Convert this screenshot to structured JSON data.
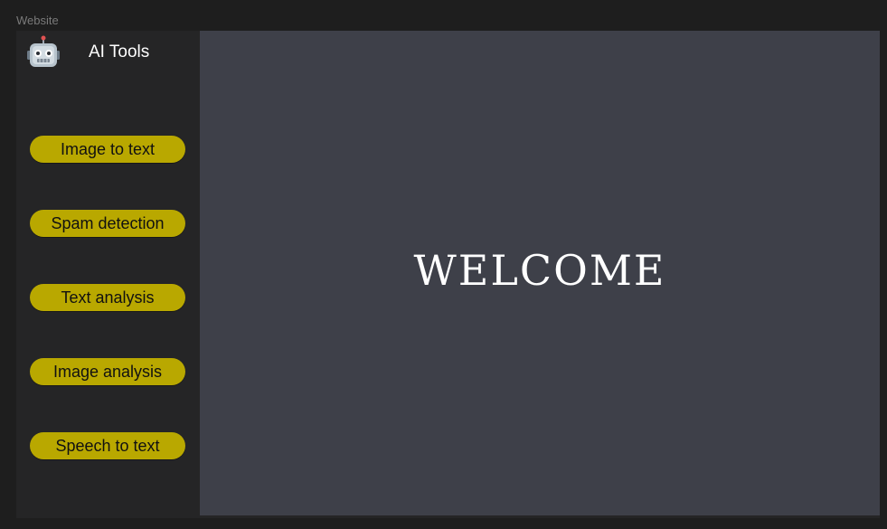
{
  "frame": {
    "label": "Website"
  },
  "sidebar": {
    "brand": {
      "icon": "robot-icon",
      "title": "AI Tools"
    },
    "items": [
      {
        "label": "Image to text"
      },
      {
        "label": "Spam detection"
      },
      {
        "label": "Text analysis"
      },
      {
        "label": "Image analysis"
      },
      {
        "label": "Speech to text"
      }
    ]
  },
  "main": {
    "heading": "WELCOME"
  },
  "colors": {
    "page_background": "#1e1e1e",
    "sidebar_background": "#252526",
    "main_background": "#3e4049",
    "button_accent": "#b9a800",
    "button_text": "#111111",
    "heading_text": "#ffffff"
  }
}
